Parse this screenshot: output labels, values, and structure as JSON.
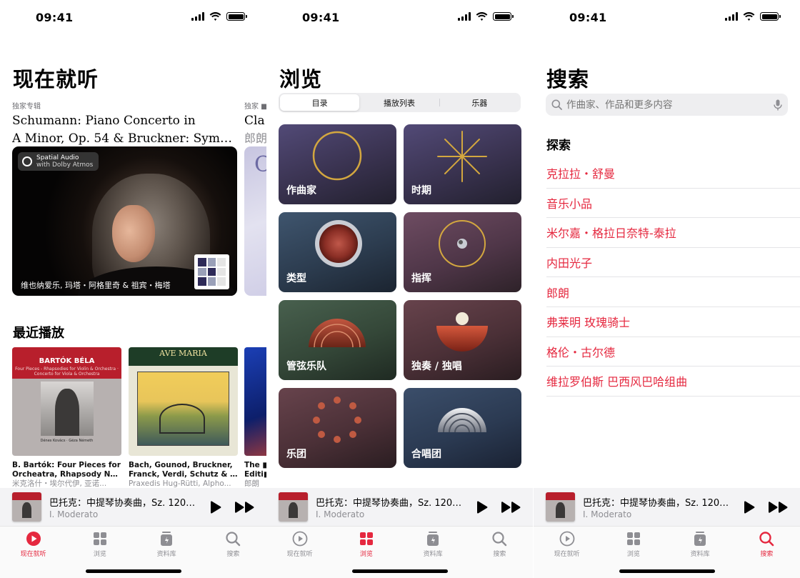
{
  "status": {
    "time": "09:41"
  },
  "listen_now": {
    "title": "现在就听",
    "feature": {
      "eyebrow": "独家专辑",
      "title_line1": "Schumann: Piano Concerto in",
      "title_line2": "A Minor, Op. 54 & Bruckner: Sympho...",
      "badge_line1": "Spatial Audio",
      "badge_line2": "with Dolby Atmos",
      "caption": "维也纳爱乐, 玛塔・阿格里奇 & 祖宾・梅塔"
    },
    "peek": {
      "eyebrow": "独家 ■",
      "title": "Cla",
      "subtitle": "郎朗"
    },
    "recent_title": "最近播放",
    "recent": [
      {
        "cover_title": "BARTÓK BÉLA",
        "cover_sub": "Four Pieces - Rhapsodies for Violin & Orchestra · Concerto for Viola & Orchestra",
        "cover_names": "Dénes Kovács · Géza Németh",
        "title_line1": "B. Bartók: Four Pieces for",
        "title_line2": "Orcheatra, Rhapsody Nos....",
        "artist": "米克洛什・埃尔代伊, 亚诺..."
      },
      {
        "cover_title": "AVE MARIA",
        "title_line1": "Bach, Gounod, Bruckner,",
        "title_line2": "Franck, Verdi, Schutz & M...",
        "artist": "Praxedis Hug-Rütti, Alpho..."
      }
    ],
    "recent_peek": {
      "title_line1": "The ■",
      "title_line2": "Editi■",
      "artist": "郎朗"
    }
  },
  "browse": {
    "title": "浏览",
    "segments": [
      "目录",
      "播放列表",
      "乐器"
    ],
    "tiles": [
      {
        "label": "作曲家"
      },
      {
        "label": "时期"
      },
      {
        "label": "类型"
      },
      {
        "label": "指挥"
      },
      {
        "label": "管弦乐队"
      },
      {
        "label": "独奏 / 独唱"
      },
      {
        "label": "乐团"
      },
      {
        "label": "合唱团"
      }
    ]
  },
  "search": {
    "title": "搜索",
    "placeholder": "作曲家、作品和更多内容",
    "explore_title": "探索",
    "suggestions": [
      "克拉拉・舒曼",
      "音乐小品",
      "米尔嘉・格拉日奈特-泰拉",
      "内田光子",
      "郎朗",
      "弗莱明 玫瑰骑士",
      "格伦・古尔德",
      "维拉罗伯斯 巴西风巴哈组曲"
    ]
  },
  "mini_player": {
    "title": "巴托克：中提琴协奏曲，Sz. 120，...",
    "subtitle": "I. Moderato"
  },
  "tabs": [
    "现在就听",
    "浏览",
    "资料库",
    "搜索"
  ],
  "colors": {
    "accent": "#e5283f",
    "inactive": "#8e8e93"
  }
}
